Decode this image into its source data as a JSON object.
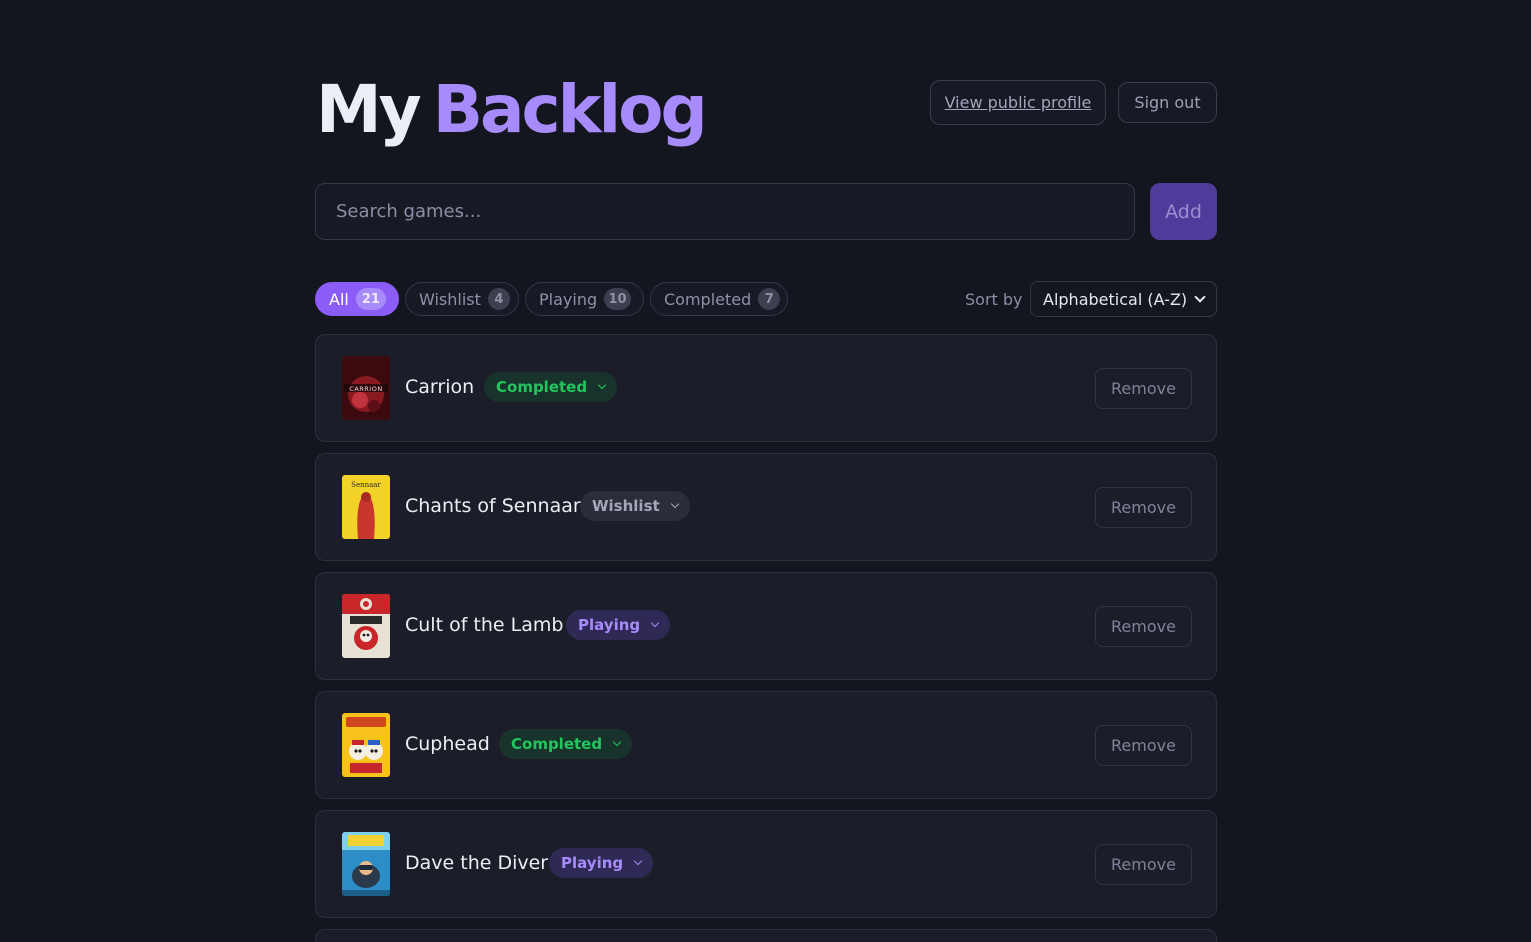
{
  "header": {
    "title_part1": "My",
    "title_part2": "Backlog",
    "profile_link": "View public profile",
    "signout": "Sign out"
  },
  "search": {
    "placeholder": "Search games...",
    "add_label": "Add"
  },
  "filters": [
    {
      "label": "All",
      "count": "21",
      "active": true
    },
    {
      "label": "Wishlist",
      "count": "4",
      "active": false
    },
    {
      "label": "Playing",
      "count": "10",
      "active": false
    },
    {
      "label": "Completed",
      "count": "7",
      "active": false
    }
  ],
  "sort": {
    "label": "Sort by",
    "selected": "Alphabetical (A-Z)"
  },
  "games": [
    {
      "name": "Carrion",
      "status": "Completed",
      "remove_label": "Remove"
    },
    {
      "name": "Chants of Sennaar",
      "status": "Wishlist",
      "remove_label": "Remove"
    },
    {
      "name": "Cult of the Lamb",
      "status": "Playing",
      "remove_label": "Remove"
    },
    {
      "name": "Cuphead",
      "status": "Completed",
      "remove_label": "Remove"
    },
    {
      "name": "Dave the Diver",
      "status": "Playing",
      "remove_label": "Remove"
    }
  ],
  "colors": {
    "background": "#14161f",
    "accent": "#8b5cf6",
    "completed": "#22c55e",
    "playing": "#a78bfa",
    "wishlist": "#a2a6b8"
  }
}
